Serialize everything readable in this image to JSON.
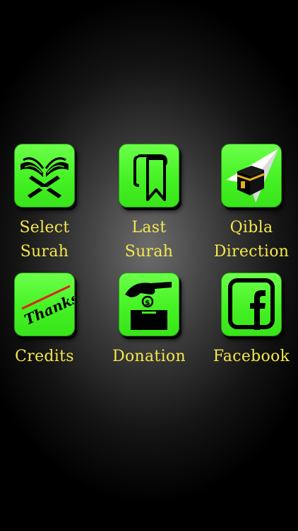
{
  "menu": {
    "items": [
      {
        "label": "Select\nSurah",
        "icon": "quran-book-icon"
      },
      {
        "label": "Last\nSurah",
        "icon": "bookmark-icon"
      },
      {
        "label": "Qibla\nDirection",
        "icon": "kaaba-compass-icon"
      },
      {
        "label": "Credits",
        "icon": "thanks-icon"
      },
      {
        "label": "Donation",
        "icon": "donation-box-icon"
      },
      {
        "label": "Facebook",
        "icon": "facebook-icon"
      }
    ]
  },
  "colors": {
    "tile_green": "#45f224",
    "label_yellow": "#f3e84c",
    "background": "#000000"
  }
}
